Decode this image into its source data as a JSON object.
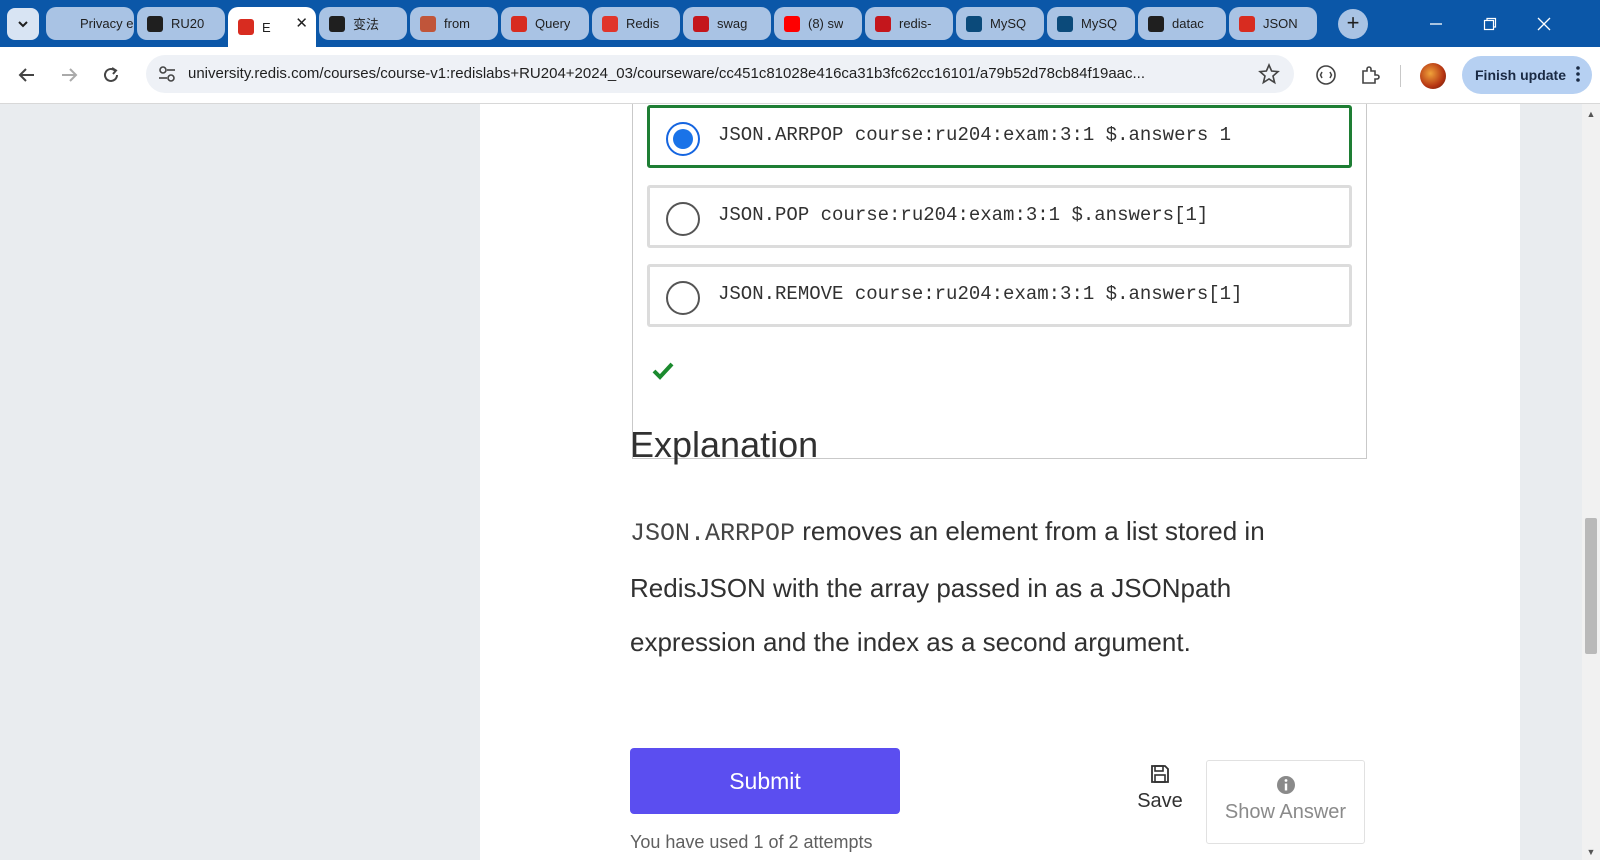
{
  "browser": {
    "tabs": [
      {
        "title": "Privacy er",
        "favicon": "privacy-favicon",
        "color": "#a9c3e4",
        "active": false
      },
      {
        "title": "RU20",
        "favicon": "github-icon",
        "color": "#1f1f1f",
        "active": false
      },
      {
        "title": "E",
        "favicon": "redis-university-icon",
        "color": "#d82c20",
        "active": true
      },
      {
        "title": "变法",
        "favicon": "chat-bot-icon",
        "color": "#1f1f1f",
        "active": false
      },
      {
        "title": "from",
        "favicon": "university-crest-icon",
        "color": "#c0553a",
        "active": false
      },
      {
        "title": "Query",
        "favicon": "redis-cube-icon",
        "color": "#d82c20",
        "active": false
      },
      {
        "title": "Redis",
        "favicon": "redis-logo-icon",
        "color": "#e0352b",
        "active": false
      },
      {
        "title": "swag",
        "favicon": "redis-square-icon",
        "color": "#c4161c",
        "active": false
      },
      {
        "title": "(8) sw",
        "favicon": "youtube-icon",
        "color": "#ff0000",
        "active": false
      },
      {
        "title": "redis-",
        "favicon": "redis-square-icon",
        "color": "#c4161c",
        "active": false
      },
      {
        "title": "MySQ",
        "favicon": "mysql-icon",
        "color": "#0b4a7a",
        "active": false
      },
      {
        "title": "MySQ",
        "favicon": "mysql-icon",
        "color": "#0b4a7a",
        "active": false
      },
      {
        "title": "datac",
        "favicon": "github-icon",
        "color": "#1f1f1f",
        "active": false
      },
      {
        "title": "JSON",
        "favicon": "redis-cube-icon",
        "color": "#d82c20",
        "active": false
      }
    ],
    "new_tab_label": "+",
    "url": "university.redis.com/courses/course-v1:redislabs+RU204+2024_03/courseware/cc451c81028e416ca31b3fc62cc16101/a79b52d78cb84f19aac...",
    "finish_update_label": "Finish update"
  },
  "question": {
    "choices": [
      {
        "text": "JSON.ARRPOP course:ru204:exam:3:1 $.answers 1",
        "selected": true
      },
      {
        "text": "JSON.POP course:ru204:exam:3:1 $.answers[1]",
        "selected": false
      },
      {
        "text": "JSON.REMOVE course:ru204:exam:3:1 $.answers[1]",
        "selected": false
      }
    ],
    "result_icon": "checkmark-icon"
  },
  "explanation": {
    "title": "Explanation",
    "code": "JSON.ARRPOP",
    "text": " removes an element from a list stored in RedisJSON with the array passed in as a JSONpath expression and the index as a second argument."
  },
  "actions": {
    "submit_label": "Submit",
    "attempts_text": "You have used 1 of 2 attempts",
    "save_label": "Save",
    "show_answer_label": "Show Answer"
  },
  "colors": {
    "tab_strip": "#0b57a8",
    "submit": "#5b4ef0",
    "correct_border": "#1e7e34",
    "radio_selected": "#1a73e8"
  }
}
